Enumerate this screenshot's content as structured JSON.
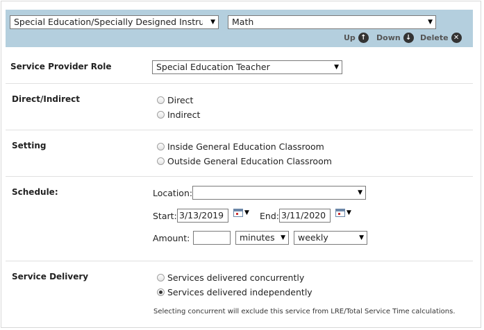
{
  "header": {
    "service_select": "Special Education/Specially Designed Instru",
    "subject_select": "Math",
    "up_label": "Up",
    "down_label": "Down",
    "delete_label": "Delete"
  },
  "provider": {
    "label": "Service Provider Role",
    "value": "Special Education Teacher"
  },
  "direct": {
    "label": "Direct/Indirect",
    "options": [
      "Direct",
      "Indirect"
    ],
    "selected": null
  },
  "setting": {
    "label": "Setting",
    "options": [
      "Inside General Education Classroom",
      "Outside General Education Classroom"
    ],
    "selected": null
  },
  "schedule": {
    "label": "Schedule:",
    "location_label": "Location:",
    "location_value": "",
    "start_label": "Start:",
    "start_value": "3/13/2019",
    "end_label": "End:",
    "end_value": "3/11/2020",
    "amount_label": "Amount:",
    "amount_value": "",
    "unit_value": "minutes",
    "frequency_value": "weekly"
  },
  "delivery": {
    "label": "Service Delivery",
    "options": [
      "Services delivered concurrently",
      "Services delivered independently"
    ],
    "selected": "Services delivered independently",
    "note": "Selecting concurrent will exclude this service from LRE/Total Service Time calculations."
  }
}
